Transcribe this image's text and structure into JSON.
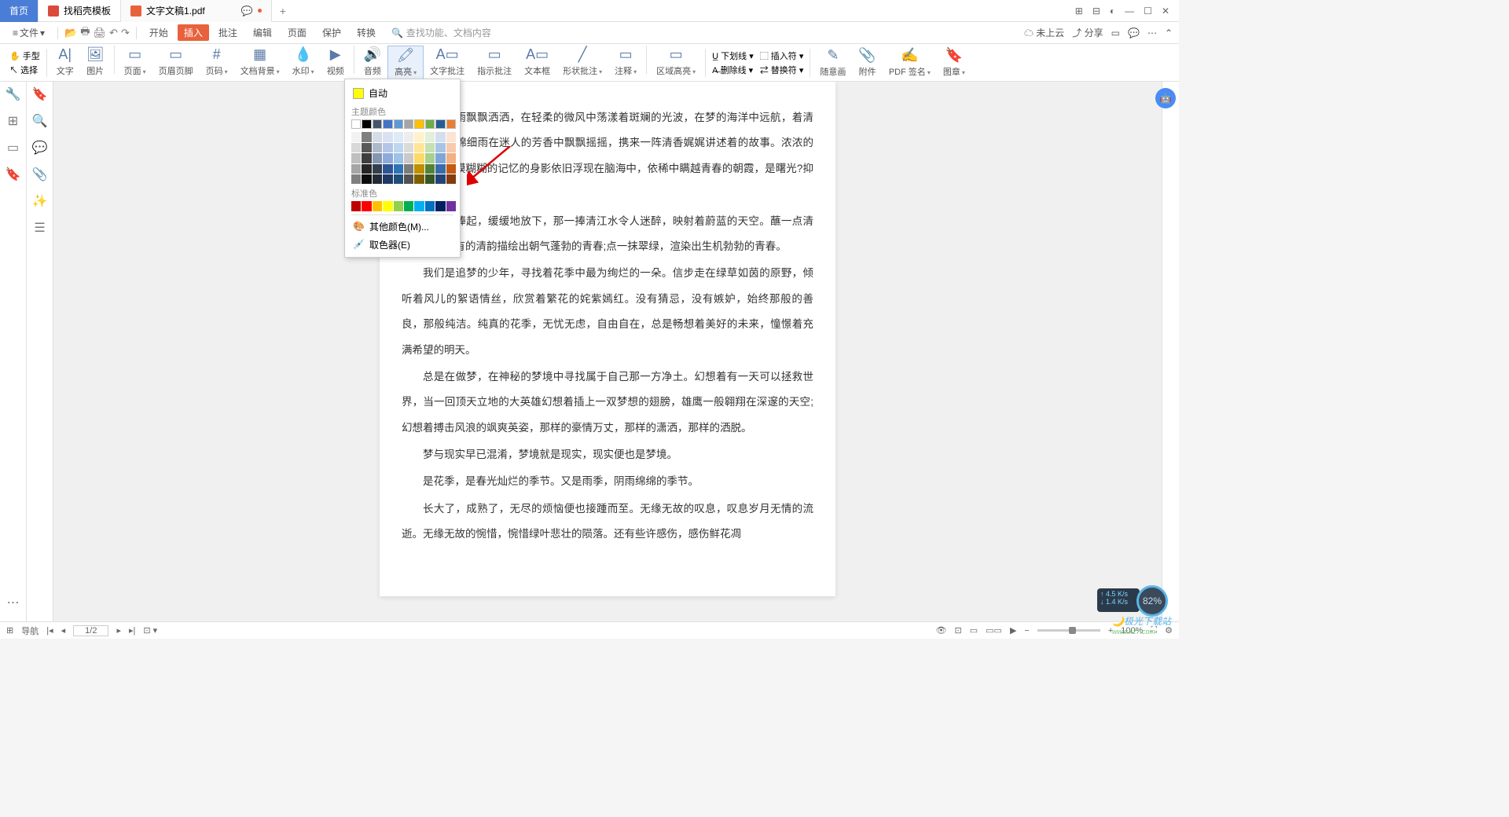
{
  "tabs": {
    "home": "首页",
    "template": "找稻壳模板",
    "doc": "文字文稿1.pdf"
  },
  "window": {
    "msg_icon": "💬",
    "layout": "⊞",
    "grid": "⊟",
    "avatar": "◐",
    "min": "—",
    "max": "☐",
    "close": "✕"
  },
  "file_menu": {
    "hamburger": "≡",
    "label": "文件",
    "drop": "▾"
  },
  "quick": {
    "open": "📂",
    "save": "🖶",
    "print": "🖨",
    "undo": "↶",
    "redo": "↷"
  },
  "menus": [
    "开始",
    "插入",
    "批注",
    "编辑",
    "页面",
    "保护",
    "转换"
  ],
  "search": {
    "icon": "🔍",
    "placeholder": "查找功能、文档内容"
  },
  "menu_right": {
    "cloud": "☁ 未上云",
    "share": "⤴ 分享",
    "box": "▭",
    "chat": "💬",
    "more": "⋯",
    "caret": "⌃"
  },
  "toolbar": {
    "left1": {
      "hand": "✋ 手型",
      "select": "↖ 选择"
    },
    "groups": [
      {
        "ico": "A|",
        "label": "文字"
      },
      {
        "ico": "🖼",
        "label": "图片"
      },
      {
        "ico": "▭",
        "label": "页面",
        "drop": true
      },
      {
        "ico": "▭",
        "label": "页眉页脚"
      },
      {
        "ico": "#",
        "label": "页码",
        "drop": true
      },
      {
        "ico": "▦",
        "label": "文档背景",
        "drop": true
      },
      {
        "ico": "💧",
        "label": "水印",
        "drop": true
      },
      {
        "ico": "▶",
        "label": "视频"
      },
      {
        "ico": "🔊",
        "label": "音频"
      },
      {
        "ico": "🖍",
        "label": "高亮",
        "drop": true,
        "sel": true
      },
      {
        "ico": "A▭",
        "label": "文字批注"
      },
      {
        "ico": "▭",
        "label": "指示批注"
      },
      {
        "ico": "A▭",
        "label": "文本框"
      },
      {
        "ico": "╱",
        "label": "形状批注",
        "drop": true
      },
      {
        "ico": "▭",
        "label": "注释",
        "drop": true
      },
      {
        "ico": "▭",
        "label": "区域高亮",
        "drop": true
      }
    ],
    "stacks": [
      {
        "top": "U̲ 下划线 ▾",
        "bot": "A̶ 删除线 ▾"
      },
      {
        "top": "⬚ 插入符 ▾",
        "bot": "⇄ 替换符 ▾"
      }
    ],
    "tail": [
      {
        "ico": "✎",
        "label": "随意画"
      },
      {
        "ico": "📎",
        "label": "附件"
      },
      {
        "ico": "✍",
        "label": "PDF 签名",
        "drop": true
      },
      {
        "ico": "🔖",
        "label": "图章",
        "drop": true
      }
    ]
  },
  "dropdown": {
    "auto": "自动",
    "theme_label": "主题颜色",
    "theme_row1": [
      "#ffffff",
      "#000000",
      "#44546a",
      "#4472c4",
      "#5b9bd5",
      "#a5a5a5",
      "#ffc000",
      "#70ad47",
      "#255e91",
      "#ed7d31"
    ],
    "theme_shades": [
      [
        "#f2f2f2",
        "#7f7f7f",
        "#d6dce5",
        "#d9e1f2",
        "#deeaf6",
        "#ededed",
        "#fff2cc",
        "#e2efd9",
        "#d3dfee",
        "#fbe4d5"
      ],
      [
        "#d8d8d8",
        "#595959",
        "#adb9ca",
        "#b4c6e7",
        "#bdd7ee",
        "#dbdbdb",
        "#ffe598",
        "#c5e0b3",
        "#a8c3e6",
        "#f7caac"
      ],
      [
        "#bfbfbf",
        "#3f3f3f",
        "#8496b0",
        "#8eaadb",
        "#9cc2e5",
        "#c9c9c9",
        "#ffd966",
        "#a8d08d",
        "#7ea6d9",
        "#f4b083"
      ],
      [
        "#a5a5a5",
        "#262626",
        "#333f4f",
        "#2f5496",
        "#2e74b5",
        "#7b7b7b",
        "#bf8f00",
        "#538135",
        "#3a6aa8",
        "#c45911"
      ],
      [
        "#7f7f7f",
        "#0c0c0c",
        "#222a35",
        "#1f3864",
        "#1f4e79",
        "#525252",
        "#7f6000",
        "#375623",
        "#244478",
        "#833c0b"
      ]
    ],
    "std_label": "标准色",
    "std": [
      "#c00000",
      "#ff0000",
      "#ffc000",
      "#ffff00",
      "#92d050",
      "#00b050",
      "#00b0f0",
      "#0070c0",
      "#002060",
      "#7030a0"
    ],
    "more": "其他颜色(M)...",
    "picker": "取色器(E)"
  },
  "doc": {
    "p1": "漫天花雨飘飘洒洒，在轻柔的微风中荡漾着斑斓的光波，在梦的海洋中远航，",
    "p1b": "着清香阵阵。绵绵细雨在迷人的芳香中飘飘摇摇，携来一阵清香娓娓讲述着",
    "p1c": "的故事。浓浓的迷雾中那模模糊糊的记忆的身影依旧浮现在脑海中，依稀中",
    "p1d": "瞒越青春的朝霞，是曙光?抑或希望之光?",
    "p2": "轻轻的捧起，缓缓地放下，那一捧清江水令人迷醉，映射着蔚蓝的天空。蘸一点清水，用它独有的清韵描绘出朝气蓬勃的青春;点一抹翠绿，渲染出生机勃勃的青春。",
    "p3": "我们是追梦的少年，寻找着花季中最为绚烂的一朵。信步走在绿草如茵的原野，倾听着风儿的絮语情丝，欣赏着繁花的姹紫嫣红。没有猜忌，没有嫉妒，始终那般的善良，那般纯洁。纯真的花季，无忧无虑，自由自在，总是畅想着美好的未来，憧憬着充满希望的明天。",
    "p4": "总是在做梦，在神秘的梦境中寻找属于自己那一方净土。幻想着有一天可以拯救世界，当一回顶天立地的大英雄幻想着插上一双梦想的翅膀，雄鹰一般翱翔在深邃的天空;幻想着搏击风浪的飒爽英姿，那样的豪情万丈，那样的潇洒，那样的洒脱。",
    "p5": "梦与现实早已混淆，梦境就是现实，现实便也是梦境。",
    "p6": "是花季，是春光灿烂的季节。又是雨季，阴雨绵绵的季节。",
    "p7": "长大了，成熟了，无尽的烦恼便也接踵而至。无缘无故的叹息，叹息岁月无情的流逝。无缘无故的惋惜，惋惜绿叶悲壮的陨落。还有些许感伤，感伤鲜花凋"
  },
  "status": {
    "nav": "导航",
    "page": "1/2",
    "eye": "👁",
    "fit": "⊡",
    "layout1": "▭",
    "layout2": "▭▭",
    "play": "▶",
    "zoom_minus": "−",
    "zoom_plus": "+",
    "zoom": "100%",
    "fullscreen": "⛶",
    "more": "⚙"
  },
  "netspeed": {
    "up": "↑ 4.5 K/s",
    "down": "↓ 1.4 K/s"
  },
  "percent": "82%",
  "watermark": {
    "main": "🌙极光下载站",
    "sub": "www.xz7.com"
  }
}
